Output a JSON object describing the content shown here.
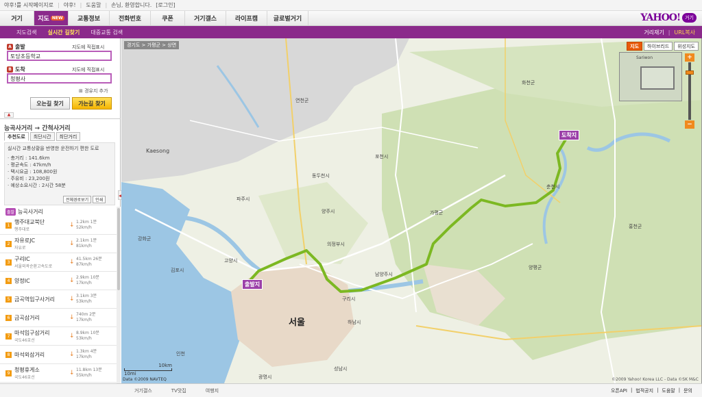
{
  "util": {
    "home": "야후!를 시작페이지로",
    "yahoo": "야후!",
    "help": "도움말",
    "greeting": "손님, 환영합니다.",
    "login": "[로그인]"
  },
  "nav": {
    "tabs": [
      "거기",
      "지도",
      "교통정보",
      "전화번호",
      "쿠폰",
      "거기갤스",
      "라이프캠",
      "글로벌거기"
    ],
    "new_badge": "NEW",
    "logo": "YAHOO!",
    "logo_kr": "거기"
  },
  "subnav": {
    "items": [
      "지도검색",
      "실시간 길찾기",
      "대중교통 검색"
    ],
    "right": [
      "거리재기",
      "URL복사"
    ]
  },
  "search": {
    "start_label": "출발",
    "start_pin": "A",
    "start_direct": "지도에 직접표시",
    "start_value": "토당초등학교",
    "end_label": "도착",
    "end_pin": "B",
    "end_direct": "지도에 직접표시",
    "end_value": "청평사",
    "waypoint": "경유지 추가",
    "btn_back": "오는길 찾기",
    "btn_go": "가는길 찾기"
  },
  "route": {
    "title": "능곡사거리 → 간척사거리",
    "tabs": [
      "추천도로",
      "최단시간",
      "최단거리"
    ],
    "desc": "실시간 교통상황을 반영한 운전하기 편한 도로",
    "stats": [
      "총거리 : 141.6km",
      "평균속도 : 47km/h",
      "택시요금 : 108,800원",
      "주유비 : 23,200원",
      "예상소요시간 : 2시간 58분"
    ],
    "btn_all": "전체경로보기",
    "btn_print": "인쇄",
    "start_badge": "출발",
    "start_name": "능곡사거리",
    "steps": [
      {
        "num": "1",
        "name": "행주대교북단",
        "sub": "행주대로",
        "dist": "1.2km 1분",
        "speed": "52km/h",
        "arrow": "↓"
      },
      {
        "num": "2",
        "name": "자유로JC",
        "sub": "자유로",
        "dist": "2.1km 1분",
        "speed": "81km/h",
        "arrow": "↓"
      },
      {
        "num": "3",
        "name": "구리IC",
        "sub": "서울외곽순환고속도로",
        "dist": "41.5km 26분",
        "speed": "87km/h",
        "arrow": "↓"
      },
      {
        "num": "4",
        "name": "양정IC",
        "sub": "",
        "dist": "2.9km 10분",
        "speed": "17km/h",
        "arrow": "↓"
      },
      {
        "num": "5",
        "name": "금곡역입구사거리",
        "sub": "",
        "dist": "3.1km 3분",
        "speed": "53km/h",
        "arrow": "↓"
      },
      {
        "num": "6",
        "name": "금곡삼거리",
        "sub": "",
        "dist": "740m 2분",
        "speed": "17km/h",
        "arrow": "↓"
      },
      {
        "num": "7",
        "name": "마석입구삼거리",
        "sub": "국도46호선",
        "dist": "8.9km 10분",
        "speed": "53km/h",
        "arrow": "↓"
      },
      {
        "num": "8",
        "name": "마석외삼거리",
        "sub": "",
        "dist": "1.3km 4분",
        "speed": "17km/h",
        "arrow": "↓"
      },
      {
        "num": "9",
        "name": "청평휴게소",
        "sub": "국도46호선",
        "dist": "11.8km 13분",
        "speed": "55km/h",
        "arrow": "↓"
      }
    ]
  },
  "map": {
    "breadcrumb": "경기도 > 가평군 > 상면",
    "types": [
      "지도",
      "하이브리드",
      "위성지도"
    ],
    "start_marker": "출발지",
    "end_marker": "도착지",
    "city": "서울",
    "scale_km": "10km",
    "scale_mi": "10mi",
    "copyright_left": "Data ©2009 NAVTEQ",
    "copyright_right": "©2009 Yahoo! Korea LLC - Data ©SK M&C",
    "labels": [
      "Kaesong",
      "연천군",
      "포천시",
      "동두천시",
      "양주시",
      "파주시",
      "의정부시",
      "가평군",
      "남양주시",
      "화천군",
      "춘천시",
      "강화군",
      "김포시",
      "고양시",
      "양평군",
      "홍천군",
      "하남시",
      "구리시",
      "인천",
      "광명시",
      "성남시"
    ],
    "minimap_label": "Sariwon"
  },
  "footer": {
    "left": [
      "거기갤스",
      "TV맛집",
      "여행지"
    ],
    "right": [
      "오픈API",
      "법적공지",
      "도움말",
      "문의"
    ]
  },
  "colors": {
    "brand": "#8b2a8b",
    "accent": "#f08a1e",
    "route": "#7cb822"
  }
}
